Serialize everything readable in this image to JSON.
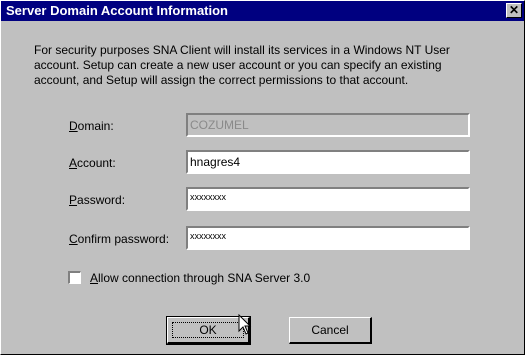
{
  "window": {
    "title": "Server Domain Account Information",
    "close_glyph": "✕"
  },
  "intro": {
    "line1": "For security purposes SNA Client will install its services in a Windows NT User",
    "line2": "account.  Setup can create a new user account or you can specify an existing",
    "line3": "account, and Setup will assign the correct permissions to that account."
  },
  "form": {
    "domain": {
      "label_key": "D",
      "label_rest": "omain:",
      "value": "COZUMEL"
    },
    "account": {
      "label_key": "A",
      "label_rest": "ccount:",
      "value": "hnagres4"
    },
    "password": {
      "label_key": "P",
      "label_rest": "assword:",
      "value": "xxxxxxxx"
    },
    "confirm": {
      "label_key": "C",
      "label_rest": "onfirm password:",
      "value": "xxxxxxxx"
    }
  },
  "checkbox": {
    "label_key": "A",
    "label_rest": "llow connection through SNA Server 3.0",
    "checked": false
  },
  "buttons": {
    "ok_label": "OK",
    "cancel_label": "Cancel"
  },
  "icons": {
    "close": "close-icon",
    "cursor": "mouse-pointer-icon"
  }
}
